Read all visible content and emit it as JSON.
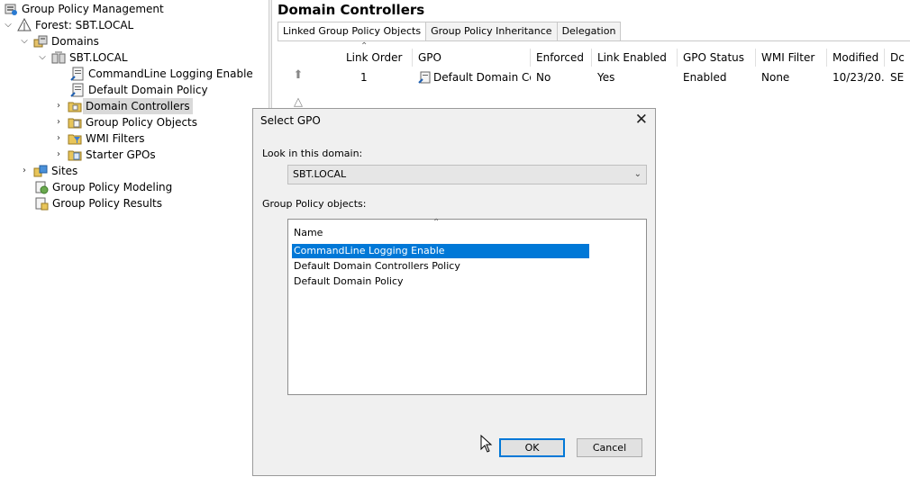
{
  "tree": {
    "root": "Group Policy Management",
    "forest": "Forest: SBT.LOCAL",
    "domains": "Domains",
    "domain": "SBT.LOCAL",
    "items": [
      "CommandLine Logging Enable",
      "Default Domain Policy",
      "Domain Controllers",
      "Group Policy Objects",
      "WMI Filters",
      "Starter GPOs"
    ],
    "sites": "Sites",
    "modeling": "Group Policy Modeling",
    "results": "Group Policy Results"
  },
  "right": {
    "title": "Domain Controllers",
    "tabs": [
      "Linked Group Policy Objects",
      "Group Policy Inheritance",
      "Delegation"
    ],
    "columns": [
      "Link Order",
      "GPO",
      "Enforced",
      "Link Enabled",
      "GPO Status",
      "WMI Filter",
      "Modified",
      "Dc"
    ],
    "row": [
      "1",
      "Default Domain Con...",
      "No",
      "Yes",
      "Enabled",
      "None",
      "10/23/20...",
      "SE"
    ]
  },
  "dialog": {
    "title": "Select GPO",
    "look_label": "Look in this domain:",
    "domain_value": "SBT.LOCAL",
    "objects_label": "Group Policy objects:",
    "column_name": "Name",
    "items": [
      "CommandLine Logging Enable",
      "Default Domain Controllers Policy",
      "Default Domain Policy"
    ],
    "ok": "OK",
    "cancel": "Cancel"
  },
  "colors": {
    "selection": "#0078d7",
    "tree_selected": "#d9d9d9"
  }
}
